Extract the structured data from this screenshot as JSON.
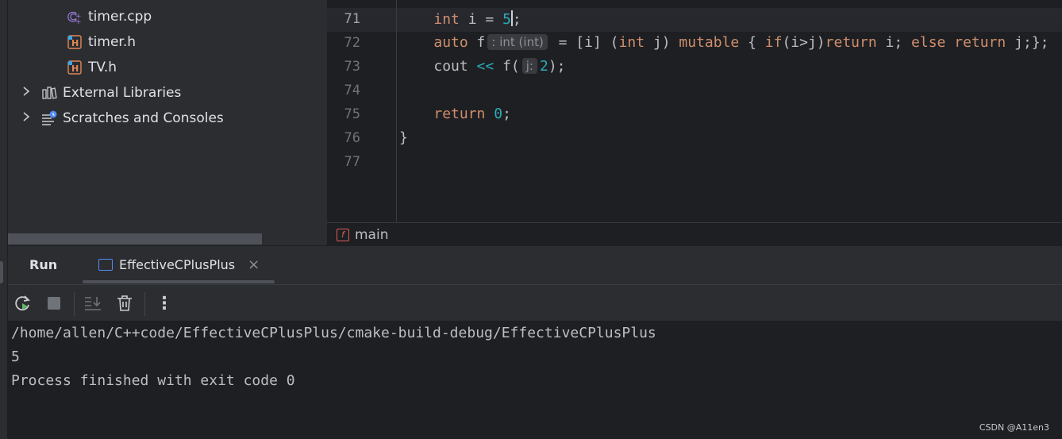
{
  "project_tree": {
    "items": [
      {
        "label": "timer.cpp",
        "icon": "cpp-file-icon"
      },
      {
        "label": "timer.h",
        "icon": "header-file-icon"
      },
      {
        "label": "TV.h",
        "icon": "header-file-icon"
      },
      {
        "label": "External Libraries",
        "icon": "library-icon"
      },
      {
        "label": "Scratches and Consoles",
        "icon": "scratches-icon"
      }
    ]
  },
  "editor": {
    "line_numbers": [
      "71",
      "72",
      "73",
      "74",
      "75",
      "76",
      "77"
    ],
    "lines": {
      "l71": {
        "indent": "    ",
        "kw_int": "int",
        "mid": " i = ",
        "num": "5",
        "end": ";"
      },
      "l72": {
        "indent": "    ",
        "kw_auto": "auto",
        "name": " f",
        "hint": ": int (int)",
        "eq": " = [i] (",
        "kw_int": "int",
        "param": " j) ",
        "kw_mutable": "mutable",
        "brace": " { ",
        "kw_if": "if",
        "cond": "(i>j)",
        "kw_return": "return",
        "ret_i": " i; ",
        "kw_else": "else",
        "sp": " ",
        "kw_return2": "return",
        "tail": " j;};"
      },
      "l73": {
        "indent": "    ",
        "cout": "cout ",
        "op": "<<",
        "call": " f(",
        "hint": "j:",
        "num": "2",
        "end": ");"
      },
      "l75": {
        "indent": "    ",
        "kw_return": "return",
        "sp": " ",
        "num": "0",
        "end": ";"
      },
      "l76": {
        "text": "}"
      }
    },
    "breadcrumb": {
      "badge": "f",
      "label": "main"
    }
  },
  "run_panel": {
    "tab_label": "Run",
    "config_label": "EffectiveCPlusPlus",
    "close_glyph": "×",
    "more_glyph": "⋮",
    "console_lines": [
      "/home/allen/C++code/EffectiveCPlusPlus/cmake-build-debug/EffectiveCPlusPlus",
      "5",
      "Process finished with exit code 0"
    ]
  },
  "watermark": "CSDN @A11en3",
  "colors": {
    "editor_bg": "#1e1f22",
    "panel_bg": "#2b2d30",
    "keyword": "#cf8e6d",
    "number": "#2aacb8"
  }
}
